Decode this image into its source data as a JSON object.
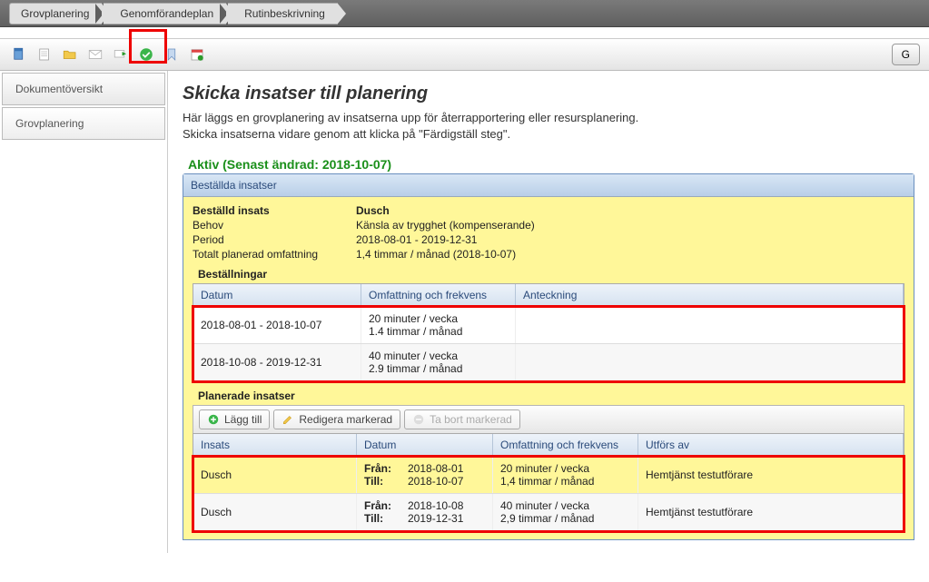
{
  "breadcrumb": {
    "items": [
      "Grovplanering",
      "Genomförandeplan",
      "Rutinbeskrivning"
    ]
  },
  "toolbar": {
    "right_btn": "G"
  },
  "sidebar": {
    "items": [
      {
        "label": "Dokumentöversikt"
      },
      {
        "label": "Grovplanering"
      }
    ]
  },
  "page": {
    "title": "Skicka insatser till planering",
    "desc1": "Här läggs en grovplanering av insatserna upp för återrapportering eller resursplanering.",
    "desc2": "Skicka insatserna vidare genom att klicka på \"Färdigställ steg\"."
  },
  "active_label": "Aktiv (Senast ändrad: 2018-10-07)",
  "panel_header": "Beställda insatser",
  "order": {
    "labels": {
      "bestalld": "Beställd insats",
      "behov": "Behov",
      "period": "Period",
      "totalt": "Totalt planerad omfattning"
    },
    "bestalld": "Dusch",
    "behov": "Känsla av trygghet (kompenserande)",
    "period": "2018-08-01  -  2019-12-31",
    "totalt": "1,4 timmar / månad (2018-10-07)"
  },
  "bestallningar": {
    "heading": "Beställningar",
    "cols": {
      "datum": "Datum",
      "omf": "Omfattning och frekvens",
      "ant": "Anteckning"
    },
    "rows": [
      {
        "datum": "2018-08-01 - 2018-10-07",
        "omf1": "20 minuter / vecka",
        "omf2": "1.4 timmar / månad",
        "ant": ""
      },
      {
        "datum": "2018-10-08 - 2019-12-31",
        "omf1": "40 minuter / vecka",
        "omf2": "2.9 timmar / månad",
        "ant": ""
      }
    ]
  },
  "planerade": {
    "heading": "Planerade insatser",
    "actions": {
      "add": "Lägg till",
      "edit": "Redigera markerad",
      "del": "Ta bort markerad"
    },
    "cols": {
      "insats": "Insats",
      "datum": "Datum",
      "omf": "Omfattning och frekvens",
      "utf": "Utförs av"
    },
    "from_label": "Från:",
    "till_label": "Till:",
    "rows": [
      {
        "insats": "Dusch",
        "from": "2018-08-01",
        "till": "2018-10-07",
        "omf1": "20 minuter / vecka",
        "omf2": "1,4 timmar / månad",
        "utf": "Hemtjänst testutförare"
      },
      {
        "insats": "Dusch",
        "from": "2018-10-08",
        "till": "2019-12-31",
        "omf1": "40 minuter / vecka",
        "omf2": "2,9 timmar / månad",
        "utf": "Hemtjänst testutförare"
      }
    ]
  }
}
